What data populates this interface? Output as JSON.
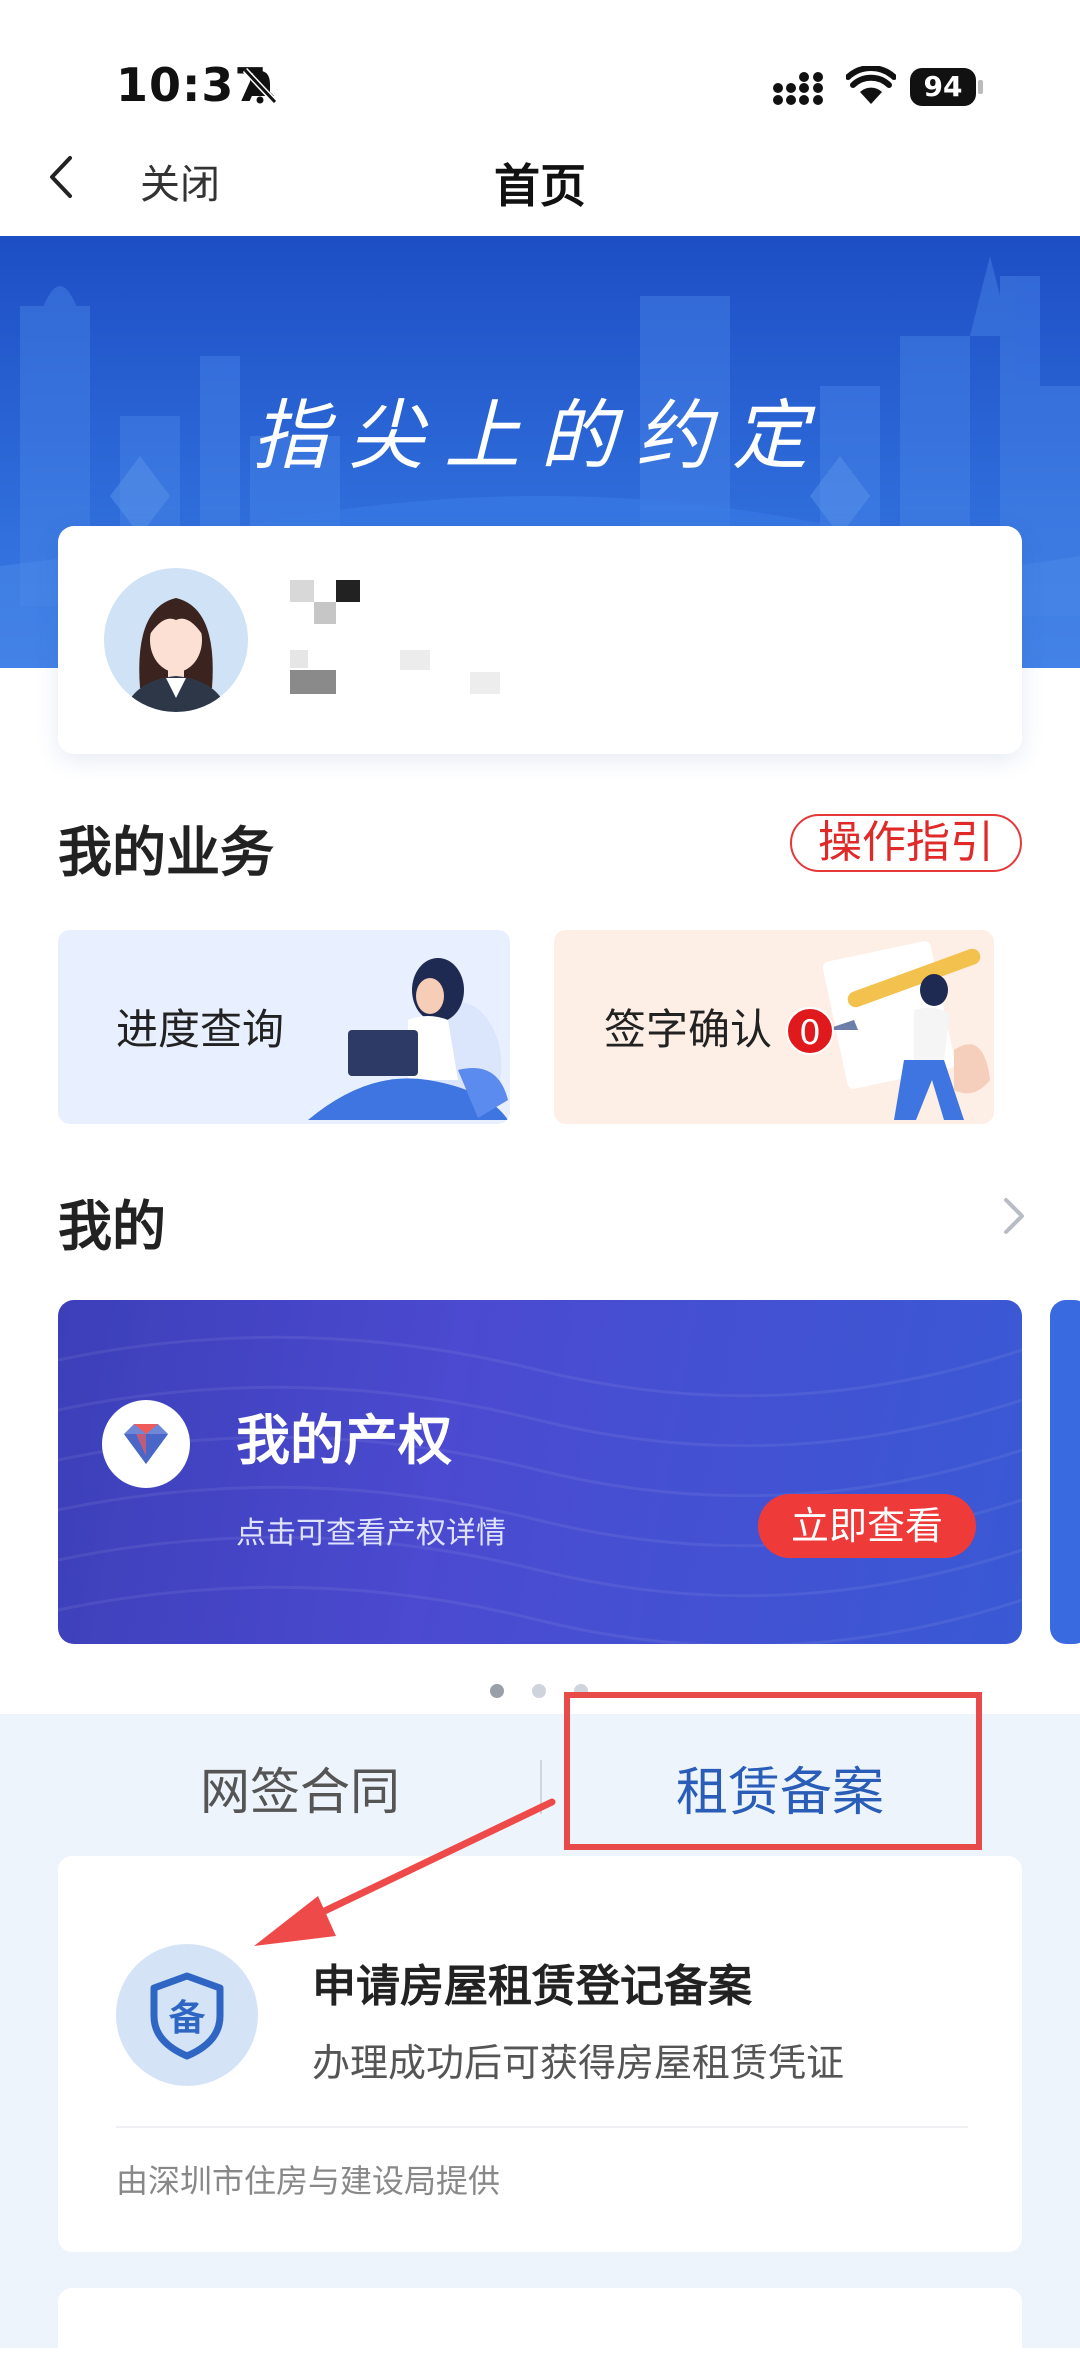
{
  "status_bar": {
    "time": "10:37",
    "battery": "94"
  },
  "nav": {
    "close_label": "关闭",
    "title": "首页"
  },
  "banner": {
    "title": "指尖上的约定"
  },
  "business": {
    "title": "我的业务",
    "guide_label": "操作指引",
    "tiles": [
      {
        "label": "进度查询"
      },
      {
        "label": "签字确认",
        "badge": "0"
      }
    ]
  },
  "mine": {
    "title": "我的",
    "card": {
      "title": "我的产权",
      "subtitle": "点击可查看产权详情",
      "button_label": "立即查看"
    }
  },
  "tabs": {
    "items": [
      {
        "label": "网签合同",
        "active": false
      },
      {
        "label": "租赁备案",
        "active": true
      }
    ]
  },
  "service": {
    "icon_char": "备",
    "title": "申请房屋租赁登记备案",
    "subtitle": "办理成功后可获得房屋租赁凭证",
    "footer": "由深圳市住房与建设局提供"
  },
  "colors": {
    "primary": "#2a5db8",
    "accent_red": "#e02a2a",
    "card_purple": "#4246c4"
  },
  "carousel": {
    "page_count": 3,
    "active_index": 0
  }
}
